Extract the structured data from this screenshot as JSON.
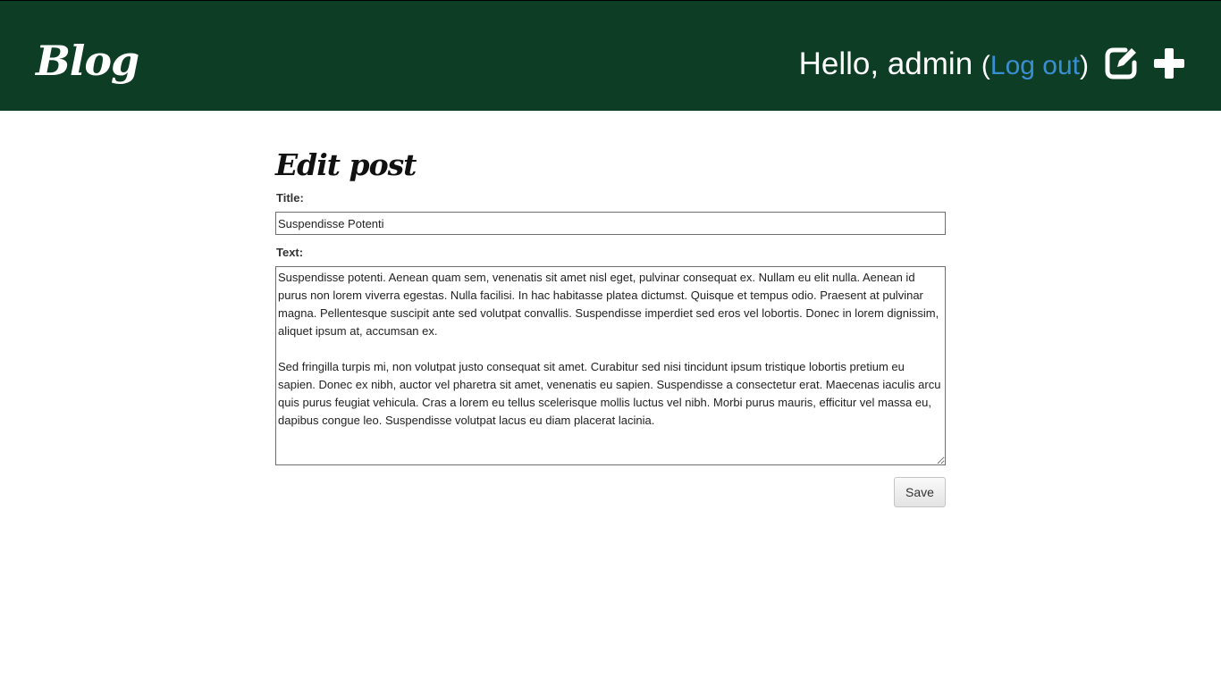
{
  "header": {
    "brand": "Blog",
    "greeting": "Hello, admin",
    "paren_open": "(",
    "logout_label": "Log out",
    "paren_close": ")",
    "icons": [
      "edit-icon",
      "plus-icon"
    ]
  },
  "form": {
    "page_title": "Edit post",
    "title_label": "Title:",
    "title_value": "Suspendisse Potenti",
    "text_label": "Text:",
    "text_value": "Suspendisse potenti. Aenean quam sem, venenatis sit amet nisl eget, pulvinar consequat ex. Nullam eu elit nulla. Aenean id purus non lorem viverra egestas. Nulla facilisi. In hac habitasse platea dictumst. Quisque et tempus odio. Praesent at pulvinar magna. Pellentesque suscipit ante sed volutpat convallis. Suspendisse imperdiet sed eros vel lobortis. Donec in lorem dignissim, aliquet ipsum at, accumsan ex.\n\nSed fringilla turpis mi, non volutpat justo consequat sit amet. Curabitur sed nisi tincidunt ipsum tristique lobortis pretium eu sapien. Donec ex nibh, auctor vel pharetra sit amet, venenatis eu sapien. Suspendisse a consectetur erat. Maecenas iaculis arcu quis purus feugiat vehicula. Cras a lorem eu tellus scelerisque mollis luctus vel nibh. Morbi purus mauris, efficitur vel massa eu, dapibus congue leo. Suspendisse volutpat lacus eu diam placerat lacinia.",
    "save_label": "Save"
  },
  "colors": {
    "header_bg": "#0e3d25",
    "link": "#3a8fd3",
    "header_text": "#ffffff"
  }
}
